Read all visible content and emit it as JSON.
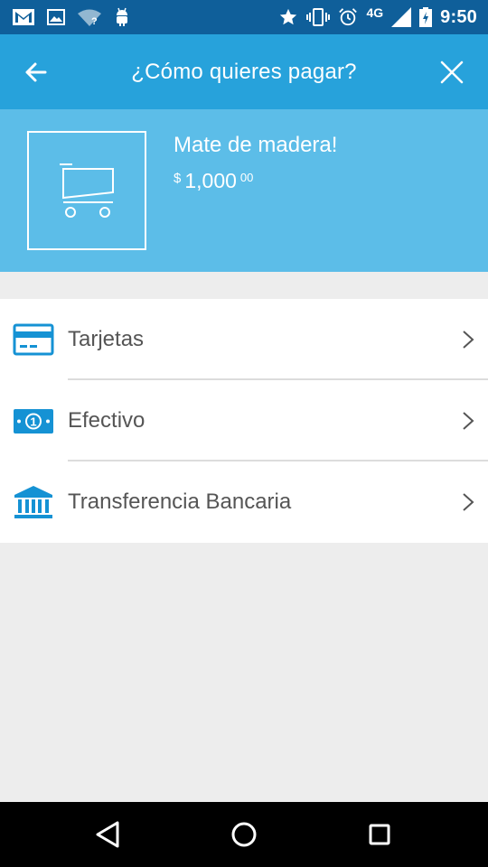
{
  "status_bar": {
    "network": "4G",
    "time": "9:50",
    "icons": [
      "gmail-icon",
      "image-icon",
      "wifi-question-icon",
      "android-icon",
      "star-icon",
      "vibrate-icon",
      "alarm-icon",
      "signal-icon",
      "battery-charging-icon"
    ]
  },
  "header": {
    "title": "¿Cómo quieres pagar?",
    "back_icon": "arrow-left-icon",
    "close_icon": "close-icon",
    "color": "#27a2db"
  },
  "summary": {
    "item_title": "Mate de madera!",
    "price_currency": "$",
    "price_main": "1,000",
    "price_cents": "00",
    "thumbnail_icon": "cart-icon",
    "color": "#5cbde8"
  },
  "payment_methods": [
    {
      "label": "Tarjetas",
      "icon": "credit-card-icon"
    },
    {
      "label": "Efectivo",
      "icon": "cash-icon"
    },
    {
      "label": "Transferencia Bancaria",
      "icon": "bank-icon"
    }
  ],
  "nav": {
    "back": "triangle-back-icon",
    "home": "circle-home-icon",
    "recents": "square-recents-icon"
  }
}
